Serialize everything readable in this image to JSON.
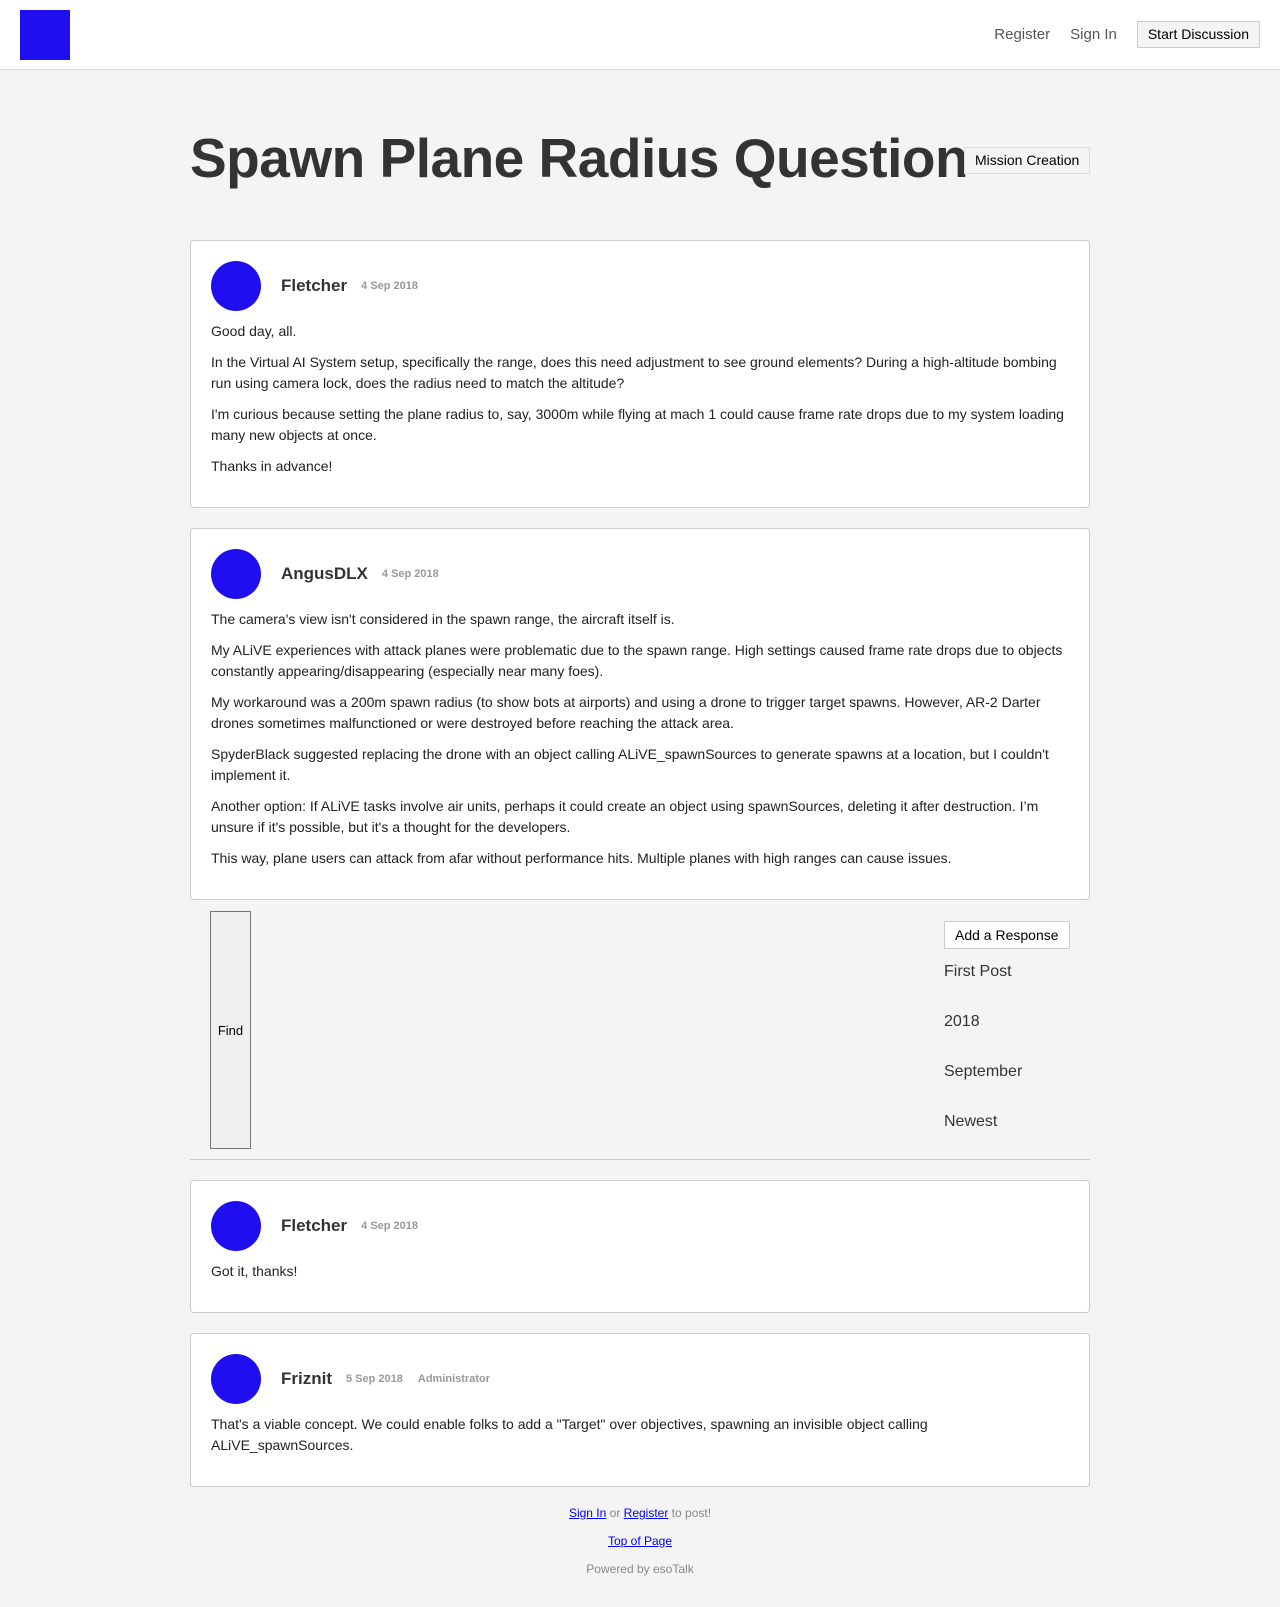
{
  "header": {
    "register": "Register",
    "sign_in": "Sign In",
    "start_discussion": "Start Discussion"
  },
  "conversation": {
    "title": "Spawn Plane Radius Question",
    "channel": "Mission Creation"
  },
  "posts": [
    {
      "author": "Fletcher",
      "date": "4 Sep 2018",
      "paragraphs": [
        "Good day, all.",
        "In the Virtual AI System setup, specifically the range, does this need adjustment to see ground elements? During a high-altitude bombing run using camera lock, does the radius need to match the altitude?",
        "I'm curious because setting the plane radius to, say, 3000m while flying at mach 1 could cause frame rate drops due to my system loading many new objects at once.",
        "Thanks in advance!"
      ]
    },
    {
      "author": "AngusDLX",
      "date": "4 Sep 2018",
      "paragraphs": [
        "The camera's view isn't considered in the spawn range, the aircraft itself is.",
        "My ALiVE experiences with attack planes were problematic due to the spawn range. High settings caused frame rate drops due to objects constantly appearing/disappearing (especially near many foes).",
        "My workaround was a 200m spawn radius (to show bots at airports) and using a drone to trigger target spawns. However, AR-2 Darter drones sometimes malfunctioned or were destroyed before reaching the attack area.",
        "SpyderBlack suggested replacing the drone with an object calling ALiVE_spawnSources to generate spawns at a location, but I couldn't implement it.",
        "Another option: If ALiVE tasks involve air units, perhaps it could create an object using spawnSources, deleting it after destruction. I’m unsure if it's possible, but it's a thought for the developers.",
        "This way, plane users can attack from afar without performance hits. Multiple planes with high ranges can cause issues."
      ]
    },
    {
      "author": "Fletcher",
      "date": "4 Sep 2018",
      "paragraphs": [
        "Got it, thanks!"
      ]
    },
    {
      "author": "Friznit",
      "date": "5 Sep 2018",
      "role": "Administrator",
      "paragraphs": [
        "That's a viable concept. We could enable folks to add a \"Target\" over objectives, spawning an invisible object calling ALiVE_spawnSources."
      ]
    }
  ],
  "scrubber": {
    "find": "Find",
    "add_response": "Add a Response",
    "first_post": "First Post",
    "year": "2018",
    "month": "September",
    "newest": "Newest"
  },
  "footer": {
    "sign_in": "Sign In",
    "or": " or ",
    "register": "Register",
    "to_post": " to post!",
    "top_of_page": "Top of Page",
    "powered": "Powered by esoTalk"
  },
  "colors": {
    "brand": "#1f0ff0",
    "background": "#f4f4f4"
  }
}
